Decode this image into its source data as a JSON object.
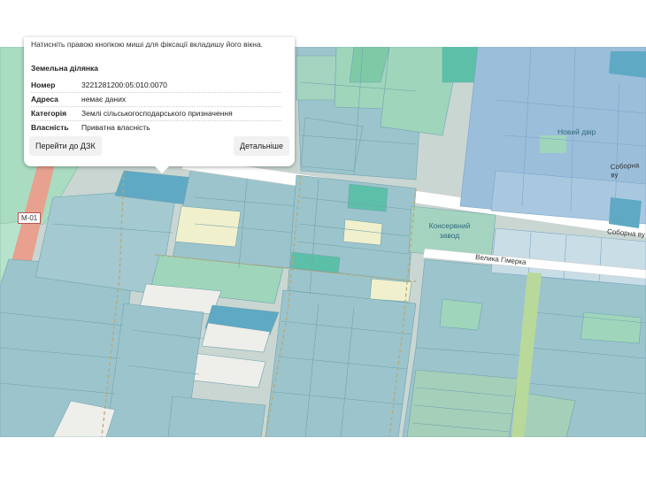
{
  "popup": {
    "cut_text": "Натисніть правою кнопкою миші для фіксації вкладишу його вікна.",
    "title": "Земельна ділянка",
    "rows": [
      {
        "label": "Номер",
        "value": "3221281200:05:010:0070"
      },
      {
        "label": "Адреса",
        "value": "немає даних"
      },
      {
        "label": "Категорія",
        "value": "Землі сільськогосподарського призначення"
      },
      {
        "label": "Власність",
        "value": "Приватна власність"
      }
    ],
    "go_button": "Перейти до ДЗК",
    "details_button": "Детальніше"
  },
  "map": {
    "place_novyi_dvir": "Новий двір",
    "place_konservnyi_line1": "Консервний",
    "place_konservnyi_line2": "завод",
    "street_sobornaia": "Соборна ву",
    "street_sobornaia_left": "Соборна ву",
    "street_velyka": "Велика Гімерка",
    "road_shield": "М-01",
    "colors": {
      "parcel_blue": "#9dc3cc",
      "parcel_green": "#9fd6bb",
      "parcel_dark_blue": "#5fa9c4",
      "parcel_teal": "#5cc0a8",
      "parcel_yellow": "#f0f0cc",
      "settlement_blue": "#9bbedb",
      "highway": "#e8a08f"
    }
  }
}
